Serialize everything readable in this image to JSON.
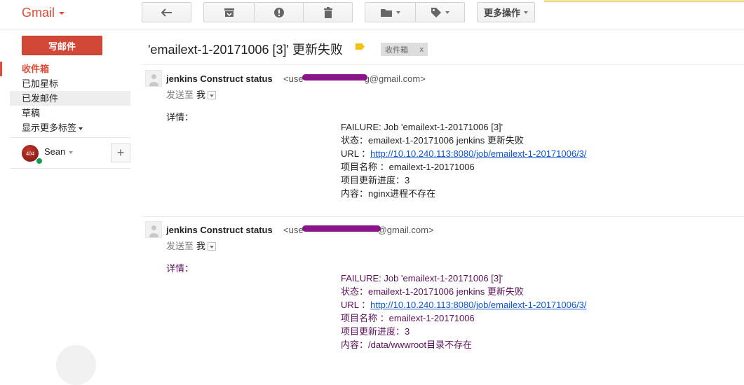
{
  "app": {
    "name": "Gmail"
  },
  "toolbar": {
    "more_label": "更多操作"
  },
  "nav": {
    "compose_label": "写邮件",
    "items": [
      {
        "label": "收件箱"
      },
      {
        "label": "已加星标"
      },
      {
        "label": "已发邮件"
      },
      {
        "label": "草稿"
      },
      {
        "label": "显示更多标签"
      }
    ]
  },
  "user": {
    "avatar_text": "404",
    "name": "Sean",
    "add_label": "+"
  },
  "thread": {
    "subject": "'emailext-1-20171006 [3]' 更新失败",
    "label_chip": "收件箱",
    "label_chip_close": "x",
    "messages": [
      {
        "sender_name": "jenkins Construct status",
        "email_prefix": "<use",
        "email_suffix": "g@gmail.com>",
        "sendto_label": "发送至",
        "sendto_me": "我",
        "detail_label": "详情：",
        "lines": {
          "failure": "FAILURE: Job 'emailext-1-20171006 [3]'",
          "status": "状态：emailext-1-20171006 jenkins 更新失败",
          "url_label": "URL ：",
          "url": "http://10.10.240.113:8080/job/emailext-1-20171006/3/",
          "project": "项目名称 ：emailext-1-20171006",
          "progress": "项目更新进度：3",
          "content": "内容：nginx进程不存在"
        }
      },
      {
        "sender_name": "jenkins Construct status",
        "email_prefix": "<use",
        "email_suffix": "@gmail.com>",
        "sendto_label": "发送至",
        "sendto_me": "我",
        "detail_label": "详情：",
        "lines": {
          "failure": "FAILURE: Job 'emailext-1-20171006 [3]'",
          "status": "状态：emailext-1-20171006 jenkins 更新失败",
          "url_label": "URL ：",
          "url": "http://10.10.240.113:8080/job/emailext-1-20171006/3/",
          "project": "项目名称 ：emailext-1-20171006",
          "progress": "项目更新进度：3",
          "content": "内容：/data/wwwroot目录不存在"
        }
      }
    ]
  },
  "colors": {
    "accent": "#dd4b39",
    "compose": "#d14836",
    "link": "#1155cc",
    "label_yellow": "#f4c20d"
  }
}
